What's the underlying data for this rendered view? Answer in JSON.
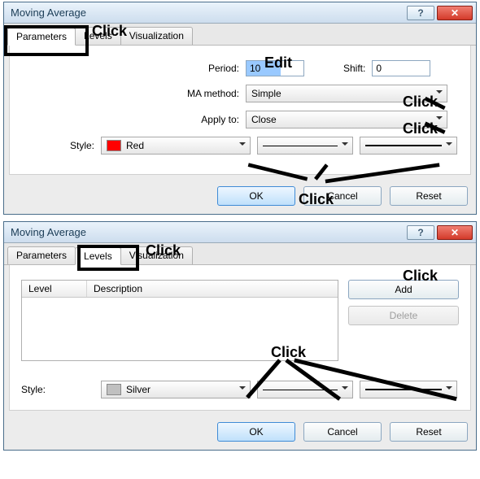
{
  "top": {
    "title": "Moving Average",
    "tabs": {
      "parameters": "Parameters",
      "levels": "Levels",
      "visualization": "Visualization"
    },
    "labels": {
      "period": "Period:",
      "shift": "Shift:",
      "mamethod": "MA method:",
      "applyto": "Apply to:",
      "style": "Style:"
    },
    "values": {
      "period": "10",
      "shift": "0",
      "mamethod": "Simple",
      "applyto": "Close",
      "colorName": "Red",
      "colorHex": "#ff0000"
    },
    "buttons": {
      "ok": "OK",
      "cancel": "Cancel",
      "reset": "Reset"
    },
    "ann": {
      "click": "Click",
      "edit": "Edit"
    }
  },
  "bot": {
    "title": "Moving Average",
    "tabs": {
      "parameters": "Parameters",
      "levels": "Levels",
      "visualization": "Visualization"
    },
    "table": {
      "col_level": "Level",
      "col_desc": "Description"
    },
    "sideButtons": {
      "add": "Add",
      "delete": "Delete"
    },
    "labels": {
      "style": "Style:"
    },
    "values": {
      "colorName": "Silver",
      "colorHex": "#c0c0c0"
    },
    "buttons": {
      "ok": "OK",
      "cancel": "Cancel",
      "reset": "Reset"
    },
    "ann": {
      "click": "Click"
    }
  }
}
